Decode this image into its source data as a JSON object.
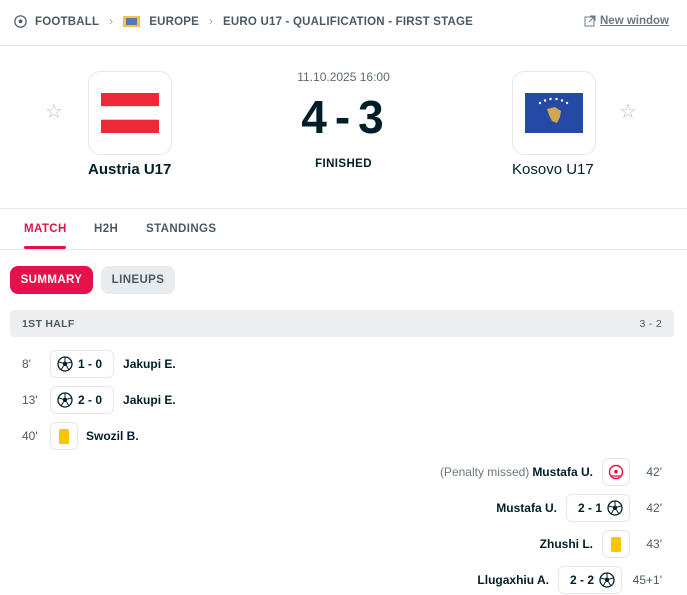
{
  "breadcrumb": {
    "sport": "FOOTBALL",
    "region": "EUROPE",
    "competition": "EURO U17 - QUALIFICATION - FIRST STAGE",
    "new_window": "New window"
  },
  "match": {
    "datetime": "11.10.2025 16:00",
    "home": {
      "name": "Austria U17",
      "flag_colors": [
        "#ed2939",
        "#ffffff",
        "#ed2939"
      ]
    },
    "away": {
      "name": "Kosovo U17",
      "flag_colors": [
        "#244aa5",
        "#d0a650"
      ]
    },
    "home_score": "4",
    "separator": "-",
    "away_score": "3",
    "status": "FINISHED"
  },
  "tabs": [
    {
      "label": "MATCH",
      "active": true
    },
    {
      "label": "H2H",
      "active": false
    },
    {
      "label": "STANDINGS",
      "active": false
    }
  ],
  "subtabs": [
    {
      "label": "SUMMARY",
      "active": true
    },
    {
      "label": "LINEUPS",
      "active": false
    }
  ],
  "half": {
    "label": "1ST HALF",
    "score": "3 - 2"
  },
  "incidents": [
    {
      "side": "home",
      "time": "8'",
      "type": "goal",
      "score": "1 - 0",
      "player": "Jakupi E."
    },
    {
      "side": "home",
      "time": "13'",
      "type": "goal",
      "score": "2 - 0",
      "player": "Jakupi E."
    },
    {
      "side": "home",
      "time": "40'",
      "type": "yellow-card",
      "player": "Swozil B."
    },
    {
      "side": "away",
      "time": "42'",
      "type": "penalty-missed",
      "note": "(Penalty missed)",
      "player": "Mustafa U."
    },
    {
      "side": "away",
      "time": "42'",
      "type": "goal",
      "score": "2 - 1",
      "player": "Mustafa U."
    },
    {
      "side": "away",
      "time": "43'",
      "type": "yellow-card",
      "player": "Zhushi L."
    },
    {
      "side": "away",
      "time": "45+1'",
      "type": "goal",
      "score": "2 - 2",
      "player": "Llugaxhiu A."
    }
  ],
  "colors": {
    "accent": "#e8104a",
    "yellow_card": "#f7c400",
    "text": "#001e28"
  }
}
